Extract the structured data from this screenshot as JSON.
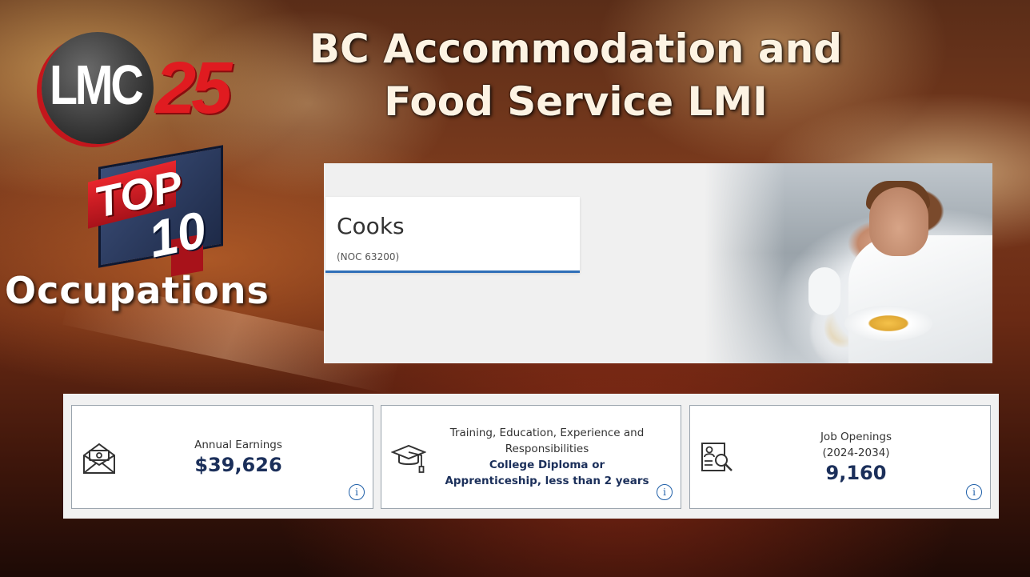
{
  "header": {
    "title_line1": "BC Accommodation and",
    "title_line2": "Food Service LMI"
  },
  "branding": {
    "logo_text": "LMC",
    "logo_number": "25",
    "badge_top": "TOP",
    "badge_number": "10",
    "subtitle": "Occupations"
  },
  "occupation": {
    "name": "Cooks",
    "noc": "(NOC 63200)"
  },
  "stats": {
    "earnings": {
      "icon": "envelope-money-icon",
      "label": "Annual Earnings",
      "value": "$39,626",
      "info_icon": "i"
    },
    "training": {
      "icon": "graduation-cap-icon",
      "label": "Training, Education, Experience and Responsibilities",
      "value_line1": "College Diploma or",
      "value_line2": "Apprenticeship, less than 2 years",
      "info_icon": "i"
    },
    "openings": {
      "icon": "resume-search-icon",
      "label": "Job Openings",
      "period": "(2024-2034)",
      "value": "9,160",
      "info_icon": "i"
    }
  },
  "colors": {
    "accent_blue": "#2f6fb8",
    "value_navy": "#1b2f5a",
    "brand_red": "#e01b20"
  }
}
